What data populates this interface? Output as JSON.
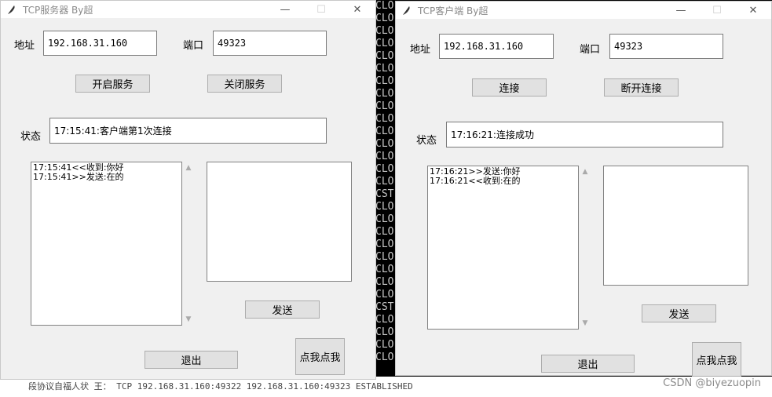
{
  "background": {
    "terminal_lines": [
      "CLO",
      "CLO",
      "CLO",
      "CLO",
      "CLO",
      "CLO",
      "CLO",
      "CLO",
      "CLO",
      "CLO",
      "CLO",
      "CLO",
      "CLO",
      "CLO",
      "CLO",
      "CST",
      "CLO",
      "CLO",
      "CLO",
      "CLO",
      "CLO",
      "CLO",
      "CLO",
      "CLO",
      "CST",
      "CLO",
      "CLO",
      "CLO",
      "CLO"
    ],
    "bottom_strip": "段协议自福人状 王：  TCP   192.168.31.160:49322   192.168.31.160:49323   ESTABLISHED",
    "watermark": "CSDN @biyezuopin"
  },
  "server": {
    "title": "TCP服务器  By超",
    "address_label": "地址",
    "address_value": "192.168.31.160",
    "port_label": "端口",
    "port_value": "49323",
    "start_button": "开启服务",
    "stop_button": "关闭服务",
    "status_label": "状态",
    "status_value": "17:15:41:客户端第1次连接",
    "log": [
      "17:15:41<<收到:你好",
      "17:15:41>>发送:在的"
    ],
    "send_button": "发送",
    "exit_button": "退出",
    "click_button": "点我点我"
  },
  "client": {
    "title": "TCP客户端  By超",
    "address_label": "地址",
    "address_value": "192.168.31.160",
    "port_label": "端口",
    "port_value": "49323",
    "connect_button": "连接",
    "disconnect_button": "断开连接",
    "status_label": "状态",
    "status_value": "17:16:21:连接成功",
    "log": [
      "17:16:21>>发送:你好",
      "17:16:21<<收到:在的"
    ],
    "send_button": "发送",
    "exit_button": "退出",
    "click_button": "点我点我"
  },
  "window_controls": {
    "minimize": "—",
    "maximize": "☐",
    "close": "✕"
  }
}
